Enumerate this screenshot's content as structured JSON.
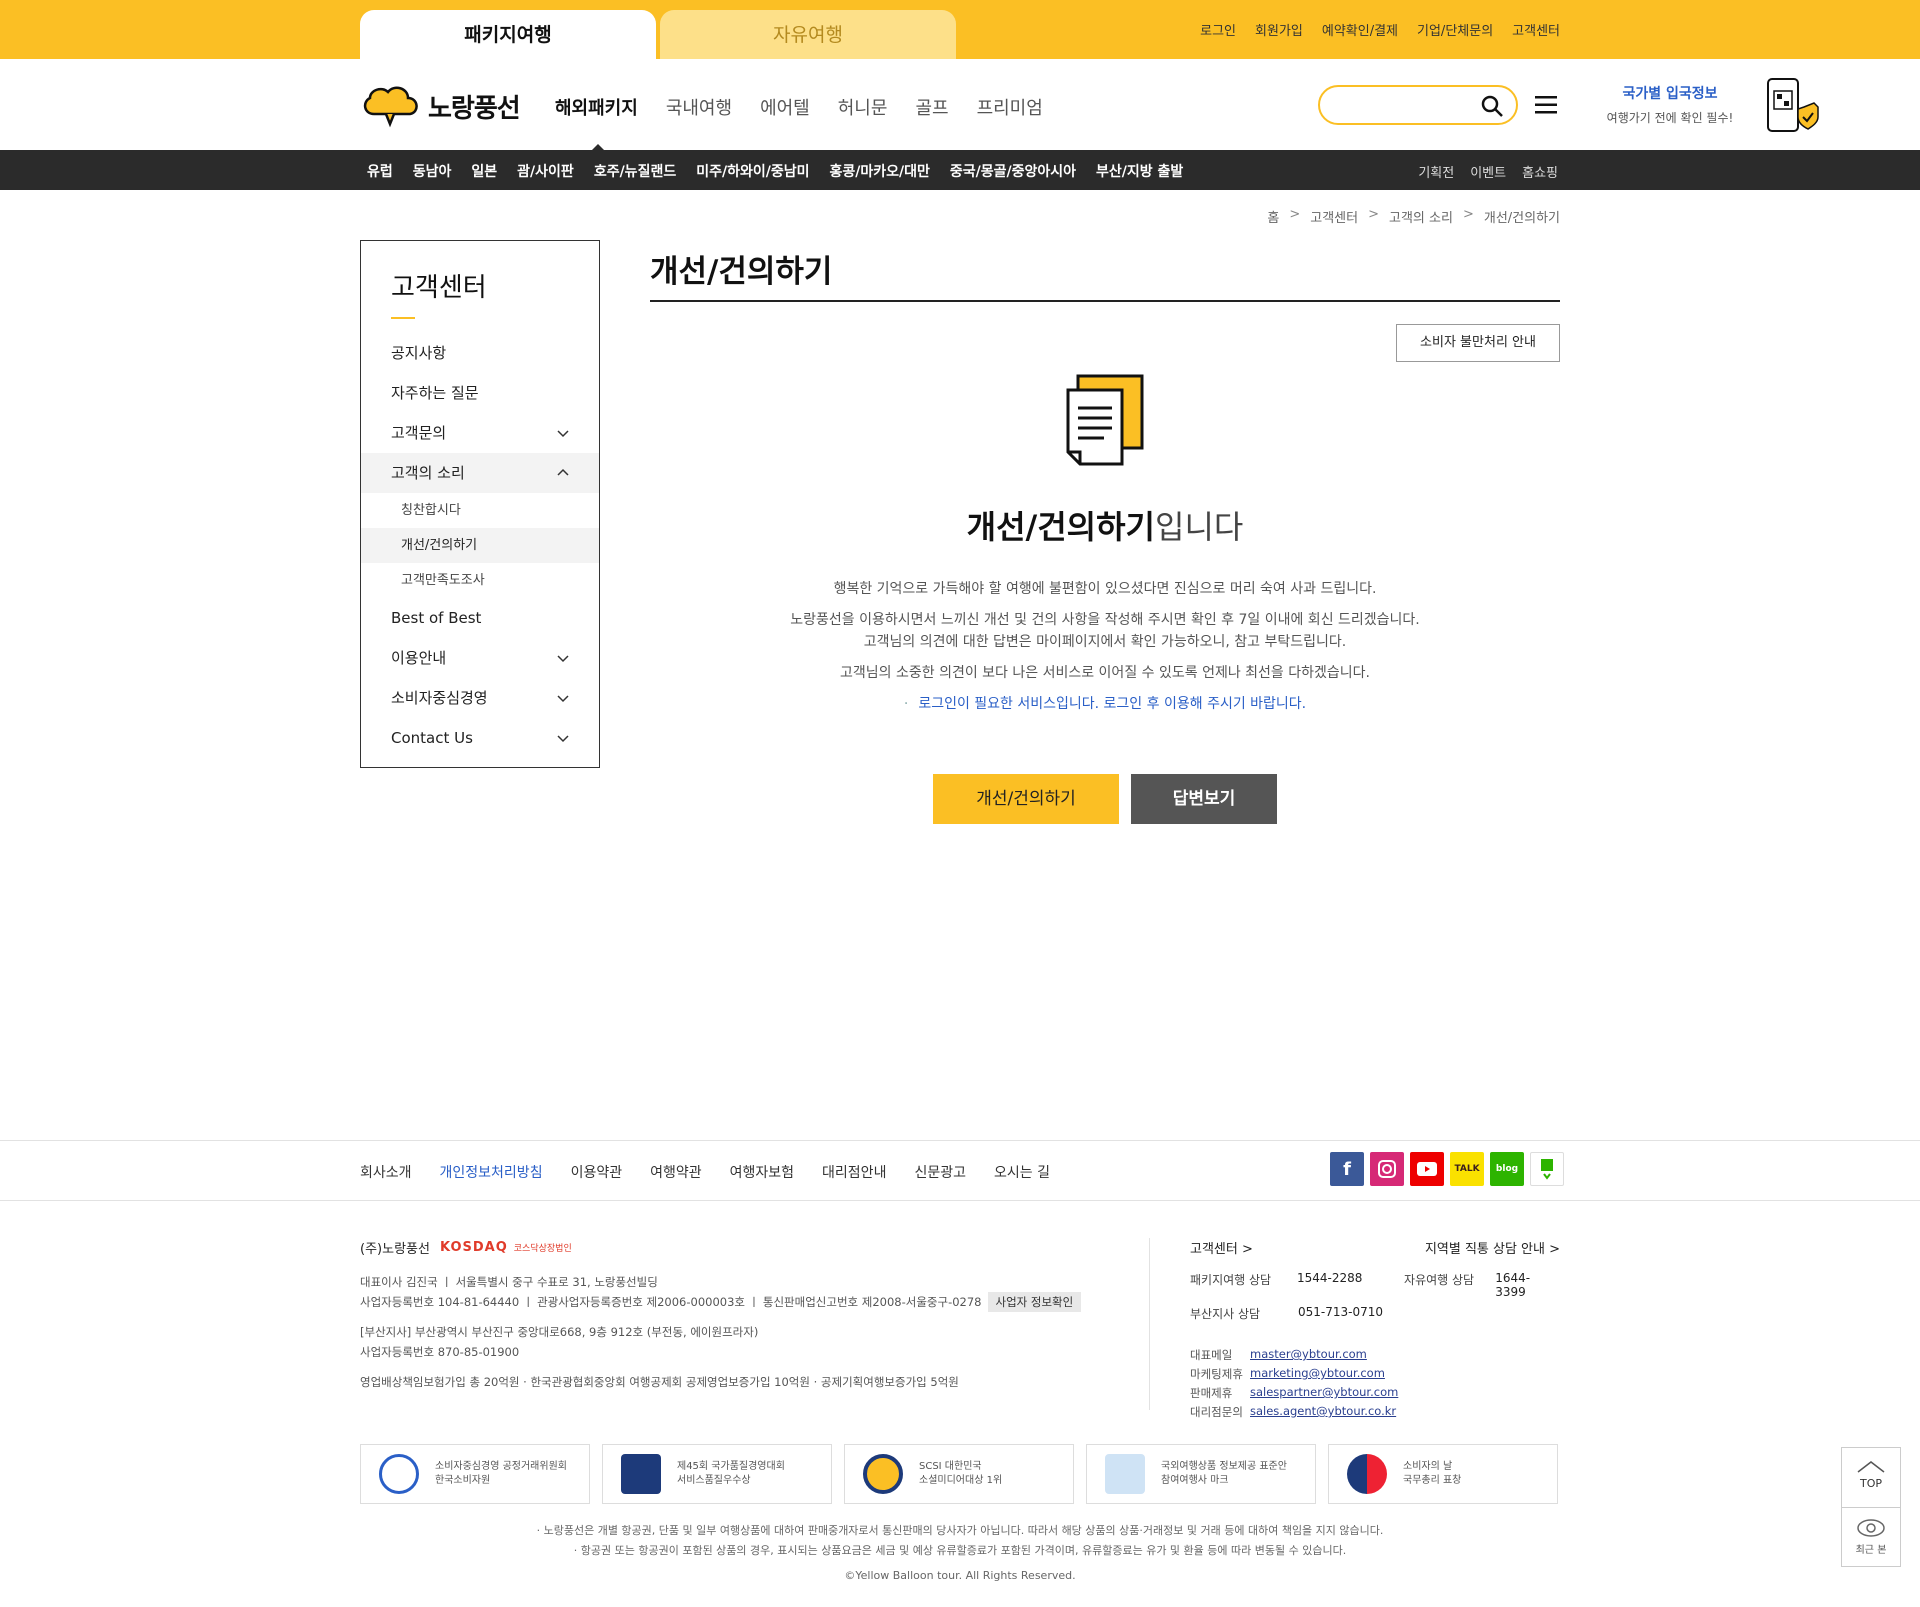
{
  "tabs": {
    "package": "패키지여행",
    "free": "자유여행"
  },
  "topnav": [
    "로그인",
    "회원가입",
    "예약확인/결제",
    "기업/단체문의",
    "고객센터"
  ],
  "logo": {
    "text": "노랑풍선"
  },
  "mainnav": [
    "해외패키지",
    "국내여행",
    "에어텔",
    "허니문",
    "골프",
    "프리미엄"
  ],
  "pass": {
    "title": "국가별 입국정보",
    "sub": "여행가기 전에 확인 필수!"
  },
  "subnav": {
    "left": [
      "유럽",
      "동남아",
      "일본",
      "괌/사이판",
      "호주/뉴질랜드",
      "미주/하와이/중남미",
      "홍콩/마카오/대만",
      "중국/몽골/중앙아시아",
      "부산/지방 출발"
    ],
    "right": [
      "기획전",
      "이벤트",
      "홈쇼핑"
    ]
  },
  "breadcrumb": [
    "홈",
    "고객센터",
    "고객의 소리",
    "개선/건의하기"
  ],
  "sidebar": {
    "title": "고객센터",
    "items": [
      "공지사항",
      "자주하는 질문",
      "고객문의",
      "고객의 소리",
      "Best of Best",
      "이용안내",
      "소비자중심경영",
      "Contact Us"
    ],
    "sub": [
      "칭찬합시다",
      "개선/건의하기",
      "고객만족도조사"
    ]
  },
  "content": {
    "title": "개선/건의하기",
    "consumer_btn": "소비자 불만처리 안내",
    "hero_bold": "개선/건의하기",
    "hero_rest": "입니다",
    "p1": "행복한 기억으로 가득해야 할 여행에 불편함이 있으셨다면 진심으로 머리 숙여 사과 드립니다.",
    "p2a": "노랑풍선을 이용하시면서 느끼신 개선 및 건의 사항을 작성해 주시면 확인 후 7일 이내에 회신 드리겠습니다.",
    "p2b": "고객님의 의견에 대한 답변은 마이페이지에서 확인 가능하오니, 참고 부탁드립니다.",
    "p3": "고객님의 소중한 의견이 보다 나은 서비스로 이어질 수 있도록 언제나 최선을 다하겠습니다.",
    "login_note": "로그인이 필요한 서비스입니다. 로그인 후 이용해 주시기 바랍니다.",
    "btn_write": "개선/건의하기",
    "btn_answer": "답변보기"
  },
  "footer": {
    "links": [
      "회사소개",
      "개인정보처리방침",
      "이용약관",
      "여행약관",
      "여행자보험",
      "대리점안내",
      "신문광고",
      "오시는 길"
    ],
    "sns": [
      "f",
      "ig",
      "yt",
      "TALK",
      "blog",
      "post"
    ],
    "company": "(주)노랑풍선",
    "kosdaq": "KOSDAQ",
    "kosdaq_sub": "코스닥상장법인",
    "info1": "대표이사 김진국 ㅣ 서울특별시 중구 수표로 31, 노랑풍선빌딩",
    "info2": "사업자등록번호 104-81-64440 ㅣ 관광사업자등록증번호 제2006-000003호 ㅣ 통신판매업신고번호 제2008-서울중구-0278",
    "info2_chip": "사업자 정보확인",
    "info3": "[부산지사] 부산광역시 부산진구 중앙대로668, 9층 912호 (부전동, 에이원프라자)",
    "info4": "사업자등록번호 870-85-01900",
    "info5": "영업배상책임보험가입 총 20억원 · 한국관광협회중앙회 여행공제회 공제영업보증가입 10억원 · 공제기획여행보증가입 5억원",
    "cs_title": "고객센터 >",
    "region_title": "지역별 직통 상담 안내 >",
    "cs_rows": [
      {
        "label": "패키지여행 상담",
        "value": "1544-2288",
        "label2": "자유여행 상담",
        "value2": "1644-3399"
      },
      {
        "label": "부산지사 상담",
        "value": "051-713-0710"
      }
    ],
    "mails": [
      {
        "label": "대표메일",
        "value": "master@ybtour.com"
      },
      {
        "label": "마케팅제휴",
        "value": "marketing@ybtour.com"
      },
      {
        "label": "판매제휴",
        "value": "salespartner@ybtour.com"
      },
      {
        "label": "대리점문의",
        "value": "sales.agent@ybtour.co.kr"
      }
    ],
    "certs": [
      {
        "l1": "소비자중심경영 공정거래위원회",
        "l2": "한국소비자원"
      },
      {
        "l1": "제45회 국가품질경영대회",
        "l2": "서비스품질우수상"
      },
      {
        "l1": "SCSI 대한민국",
        "l2": "소셜미디어대상 1위"
      },
      {
        "l1": "국외여행상품 정보제공 표준안",
        "l2": "참여여행사 마크"
      },
      {
        "l1": "소비자의 날",
        "l2": "국무총리 표창"
      }
    ],
    "disclaimer1": "· 노랑풍선은 개별 항공권, 단품 및 일부 여행상품에 대하여 판매중개자로서 통신판매의 당사자가 아닙니다. 따라서 해당 상품의 상품·거래정보 및 거래 등에 대하여 책임을 지지 않습니다.",
    "disclaimer2": "· 항공권 또는 항공권이 포함된 상품의 경우, 표시되는 상품요금은 세금 및 예상 유류할증료가 포함된 가격이며, 유류할증료는 유가 및 환율 등에 따라 변동될 수 있습니다.",
    "copyright": "©Yellow Balloon tour. All Rights Reserved."
  },
  "float": {
    "top": "TOP",
    "recent": "최근 본"
  },
  "colors": {
    "brand_yellow": "#fbbf24",
    "link_blue": "#2a5fc7",
    "dark_nav": "#2b2b2b"
  }
}
